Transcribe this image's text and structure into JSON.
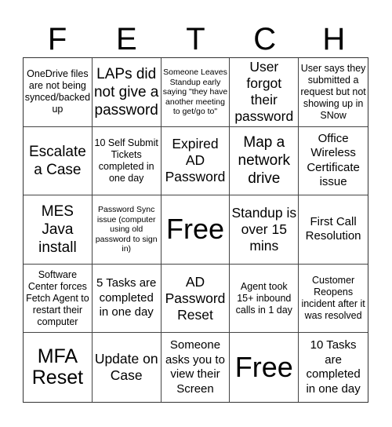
{
  "card": {
    "header_letters": [
      "F",
      "E",
      "T",
      "C",
      "H"
    ],
    "rows": [
      [
        {
          "text": "OneDrive files are not being synced/backed up",
          "size": "sm"
        },
        {
          "text": "LAPs did not give a password",
          "size": "xl"
        },
        {
          "text": "Someone Leaves Standup early saying \"they have another meeting to get/go to\"",
          "size": "xs"
        },
        {
          "text": "User forgot their password",
          "size": "lg"
        },
        {
          "text": "User says they submitted a request but not showing up in SNow",
          "size": "sm"
        }
      ],
      [
        {
          "text": "Escalate a Case",
          "size": "xl"
        },
        {
          "text": "10 Self Submit Tickets completed in one day",
          "size": "sm"
        },
        {
          "text": "Expired AD Password",
          "size": "lg"
        },
        {
          "text": "Map a network drive",
          "size": "xl"
        },
        {
          "text": "Office Wireless Certificate issue",
          "size": "md"
        }
      ],
      [
        {
          "text": "MES Java install",
          "size": "xl"
        },
        {
          "text": "Password Sync issue (computer using old password to sign in)",
          "size": "xs"
        },
        {
          "text": "Free",
          "size": "free"
        },
        {
          "text": "Standup is over 15 mins",
          "size": "lg"
        },
        {
          "text": "First Call Resolution",
          "size": "md"
        }
      ],
      [
        {
          "text": "Software Center forces Fetch Agent to restart their computer",
          "size": "sm"
        },
        {
          "text": "5 Tasks are completed in one day",
          "size": "md"
        },
        {
          "text": "AD Password Reset",
          "size": "lg"
        },
        {
          "text": "Agent took 15+ inbound calls in 1 day",
          "size": "sm"
        },
        {
          "text": "Customer Reopens incident after it was resolved",
          "size": "sm"
        }
      ],
      [
        {
          "text": "MFA Reset",
          "size": "xxl"
        },
        {
          "text": "Update on Case",
          "size": "lg"
        },
        {
          "text": "Someone asks you to view their Screen",
          "size": "md"
        },
        {
          "text": "Free",
          "size": "free"
        },
        {
          "text": "10 Tasks are completed in one day",
          "size": "md"
        }
      ]
    ]
  }
}
